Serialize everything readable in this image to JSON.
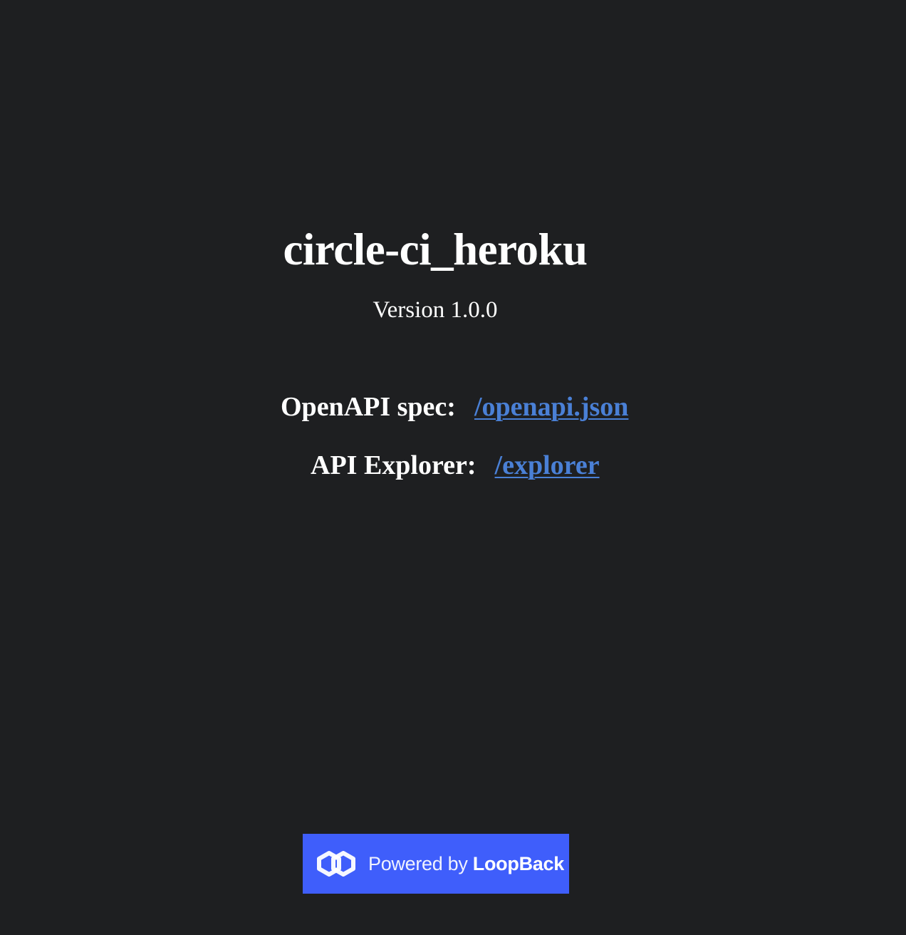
{
  "app": {
    "title": "circle-ci_heroku",
    "version_text": "Version 1.0.0"
  },
  "links": {
    "openapi": {
      "label": "OpenAPI spec:",
      "text": "/openapi.json"
    },
    "explorer": {
      "label": "API Explorer:",
      "text": "/explorer"
    }
  },
  "footer": {
    "badge_prefix": "Powered by",
    "badge_brand": "LoopBack",
    "badge_icon": "loopback-logo-icon"
  },
  "colors": {
    "background": "#1e1f21",
    "text": "#ffffff",
    "link": "#4a80d6",
    "badge_background": "#3f5efb"
  }
}
